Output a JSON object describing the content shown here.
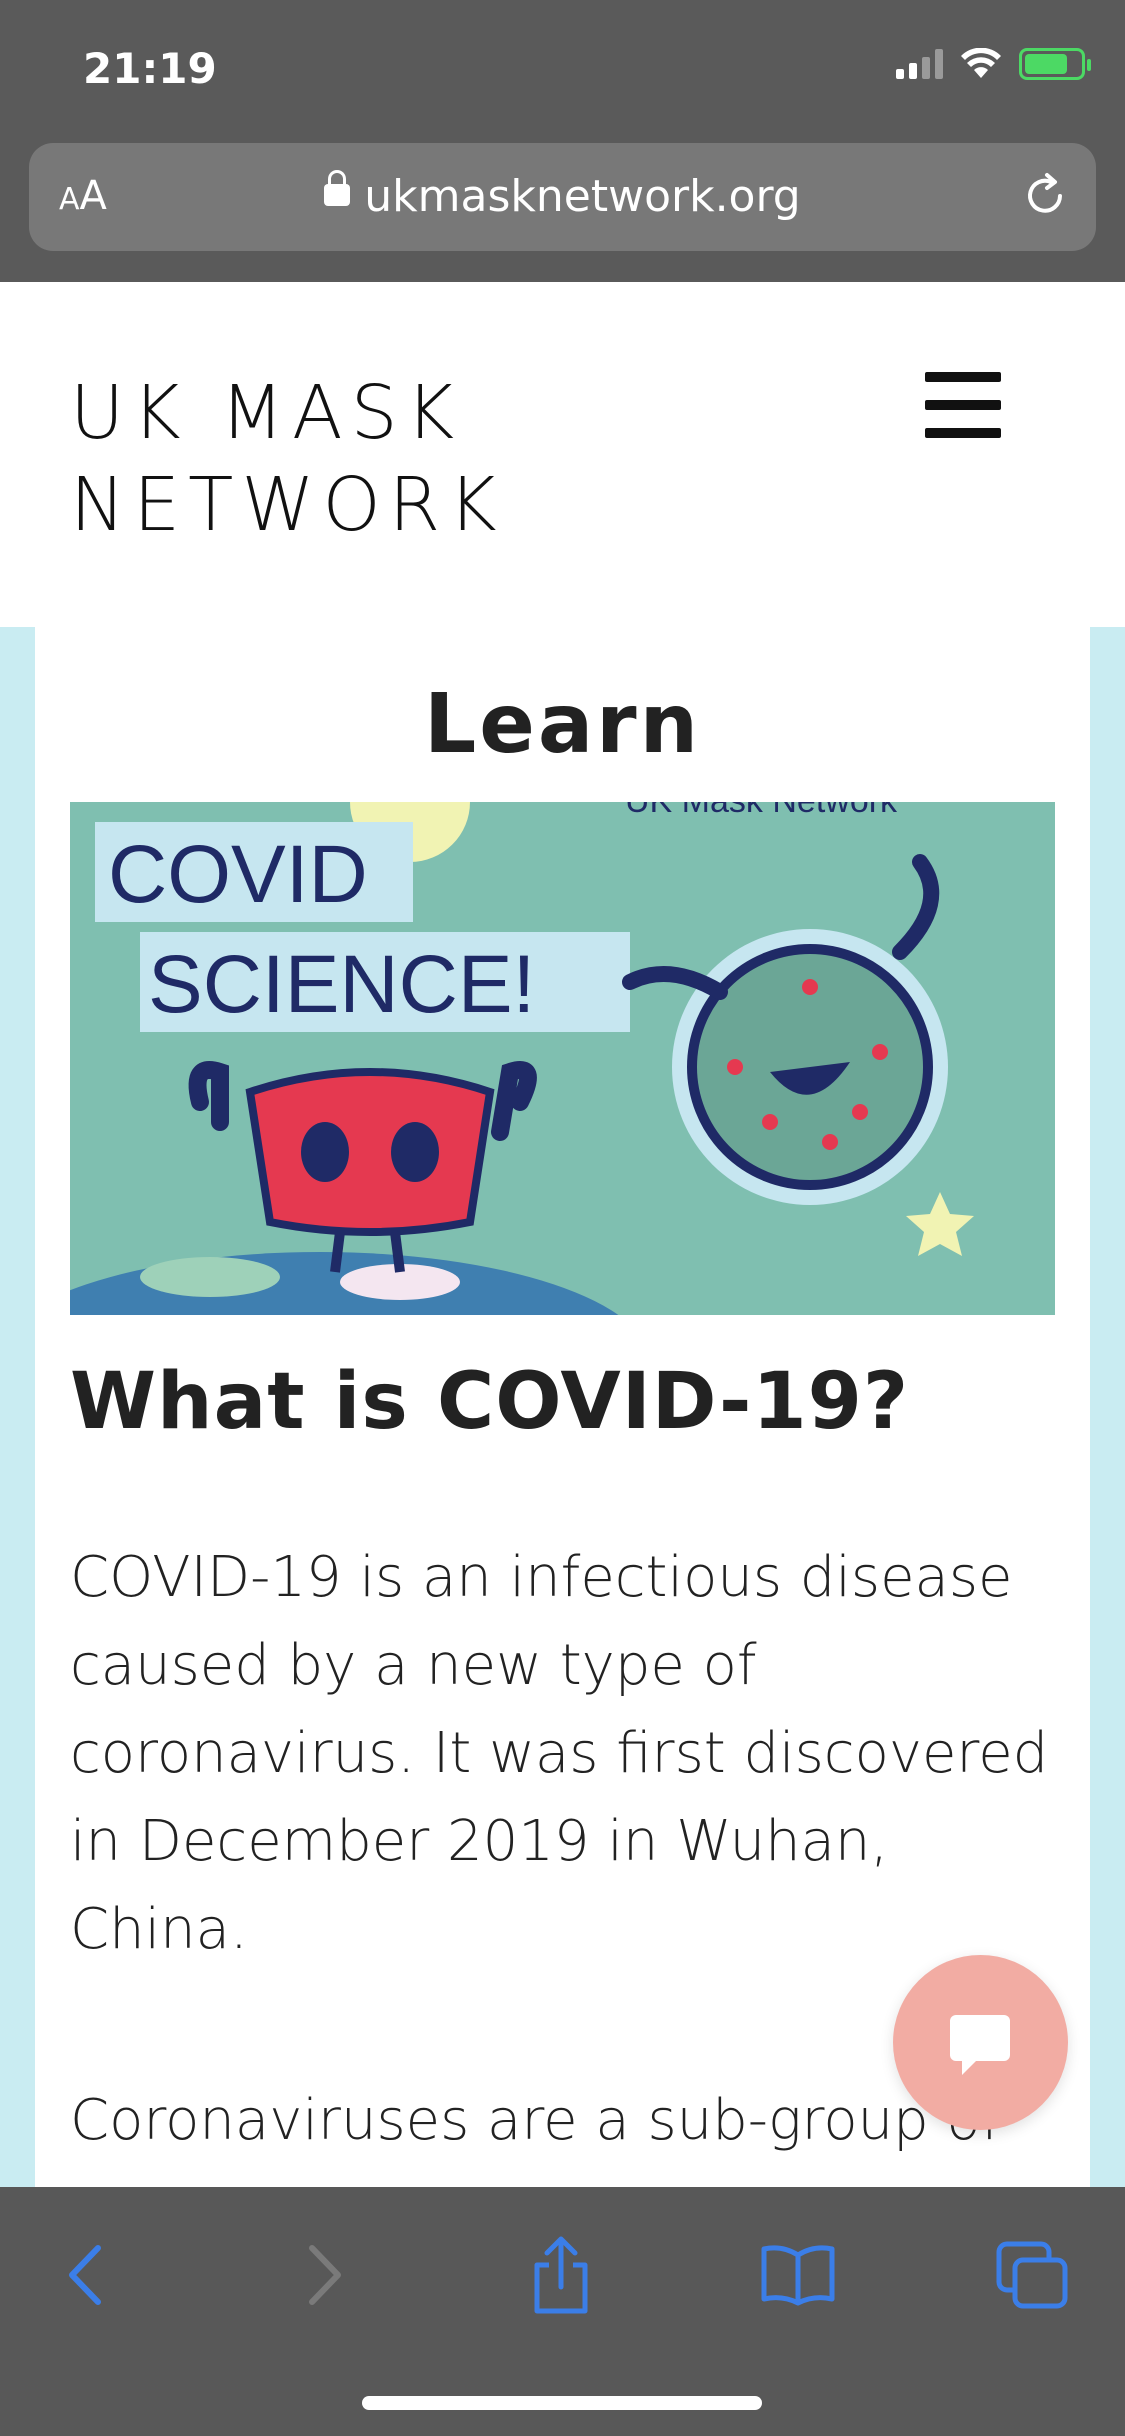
{
  "status_bar": {
    "time": "21:19"
  },
  "browser": {
    "text_size_label_small": "A",
    "text_size_label_large": "A",
    "url": "ukmasknetwork.org"
  },
  "site": {
    "logo_line1": "UK MASK",
    "logo_line2": "NETWORK"
  },
  "page": {
    "title": "Learn",
    "hero": {
      "watermark": "UK Mask Network",
      "line1": "COVID",
      "line2": "SCIENCE!"
    },
    "heading": "What is COVID-19?",
    "paragraph1": "COVID-19 is an infectious disease caused by a new type of coronavirus. It was first discovered in December 2019 in Wuhan, China.",
    "paragraph2": "Coronaviruses are a sub-group of"
  },
  "colors": {
    "chrome": "#5a5a5a",
    "page_bg": "#c9ecf2",
    "accent_blue": "#3b7ee8",
    "chat": "#f2aca3",
    "battery": "#4cd964"
  },
  "icons": [
    "lock-icon",
    "reload-icon",
    "menu-icon",
    "chat-icon",
    "back-icon",
    "forward-icon",
    "share-icon",
    "bookmarks-icon",
    "tabs-icon"
  ]
}
